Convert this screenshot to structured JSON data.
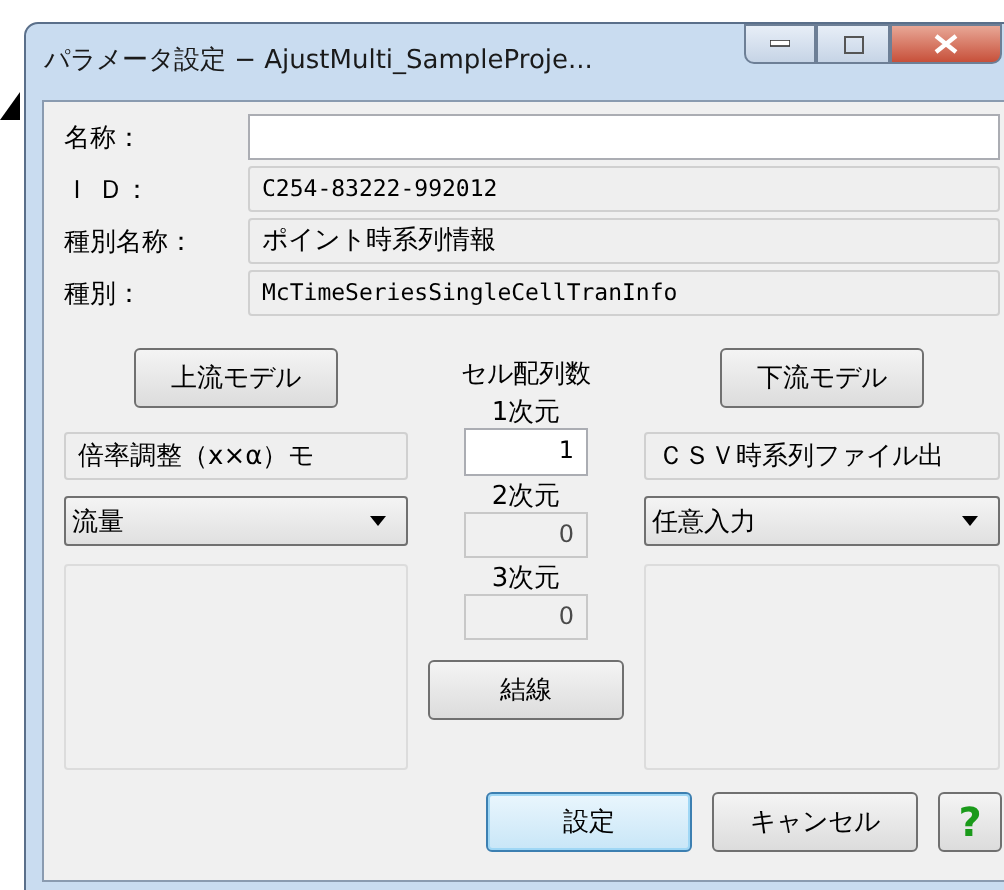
{
  "window": {
    "title": "パラメータ設定 − AjustMulti_SampleProje..."
  },
  "fields": [
    {
      "label": "名称：",
      "readonly": false
    },
    {
      "label": "Ｉ Ｄ：",
      "value": "C254-83222-992012",
      "readonly": true
    },
    {
      "label": "種別名称：",
      "value": "ポイント時系列情報",
      "readonly": true
    },
    {
      "label": "種別：",
      "value": "McTimeSeriesSingleCellTranInfo",
      "readonly": true
    }
  ],
  "upstream": {
    "button": "上流モデル",
    "model": "倍率調整（x×α）モ",
    "dropdown": "流量"
  },
  "cells": {
    "title": "セル配列数",
    "dims": [
      {
        "label": "1次元",
        "value": "1",
        "disabled": false
      },
      {
        "label": "2次元",
        "value": "0",
        "disabled": true
      },
      {
        "label": "3次元",
        "value": "0",
        "disabled": true
      }
    ],
    "button": "結線"
  },
  "downstream": {
    "button": "下流モデル",
    "model": "ＣＳＶ時系列ファイル出",
    "dropdown": "任意入力"
  },
  "buttons": [
    {
      "label": "設定",
      "default": true
    },
    {
      "label": "キャンセル",
      "default": false
    }
  ],
  "help": "?"
}
